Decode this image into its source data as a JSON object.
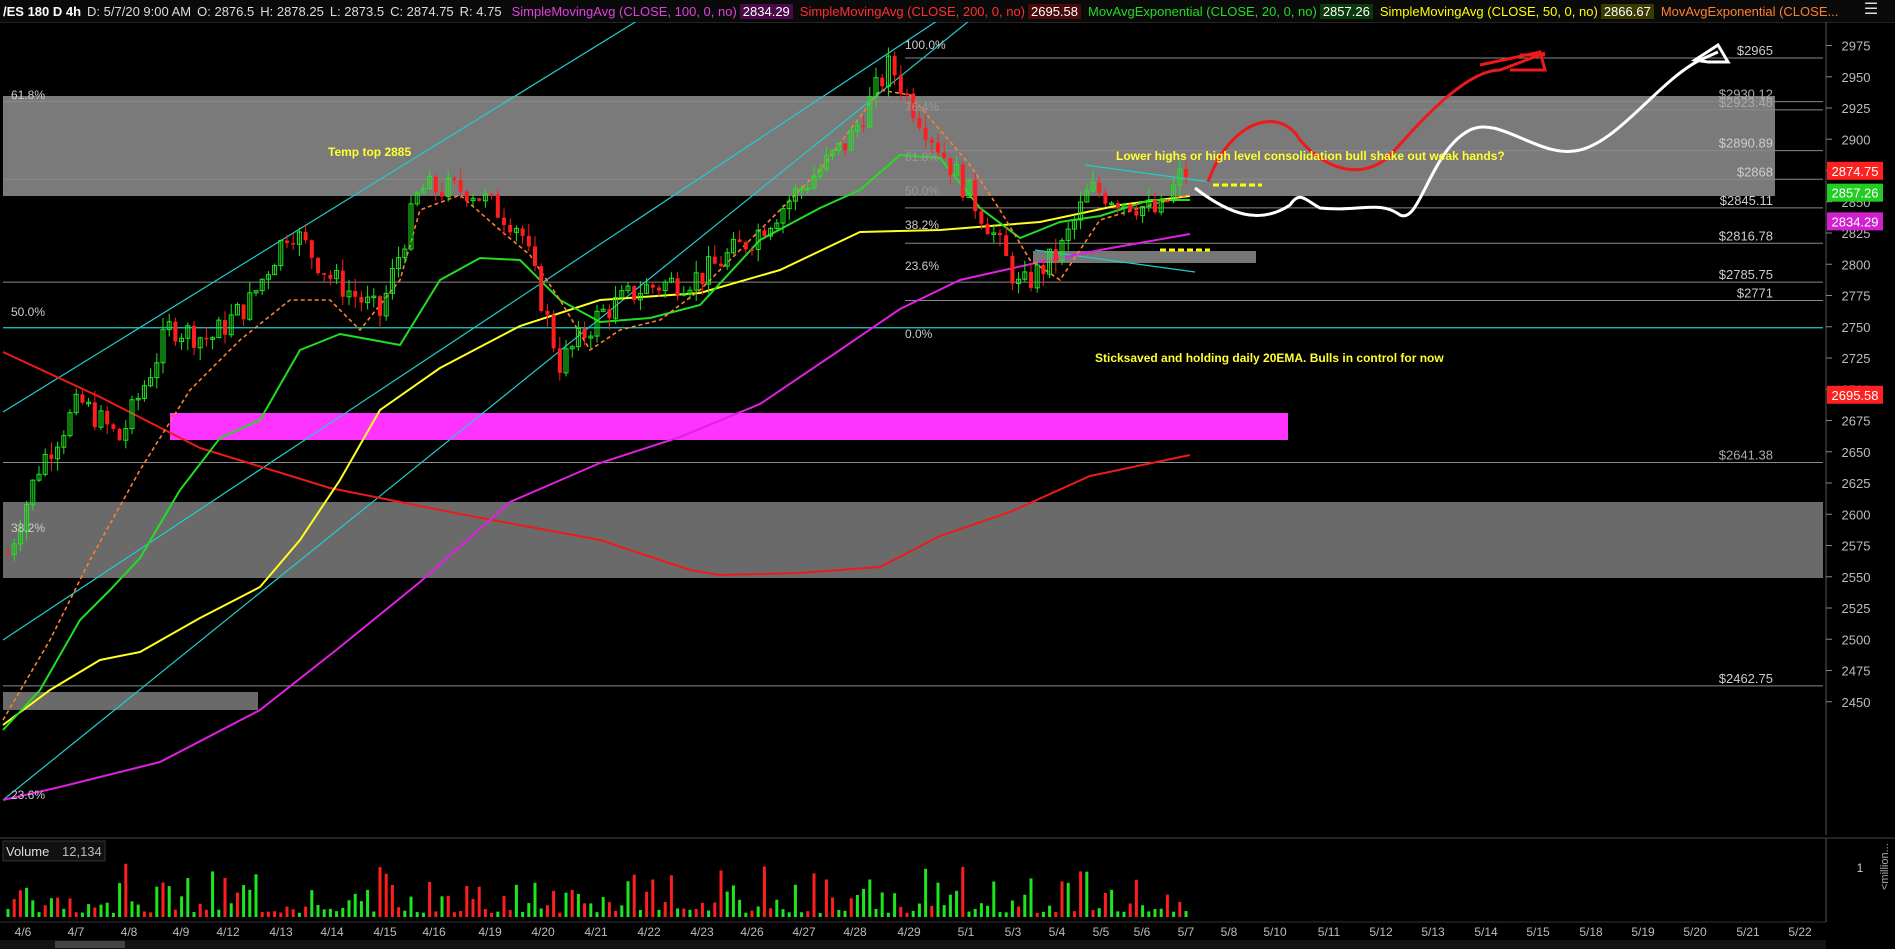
{
  "header": {
    "symbol": "/ES 180 D 4h",
    "date": "D: 5/7/20 9:00 AM",
    "open": "O: 2876.5",
    "high": "H: 2878.25",
    "low": "L: 2873.5",
    "close": "C: 2874.75",
    "range": "R: 4.75",
    "studies": [
      {
        "label": "SimpleMovingAvg (CLOSE, 100, 0, no)",
        "value": "2834.29",
        "color": "#e040e0"
      },
      {
        "label": "SimpleMovingAvg (CLOSE, 200, 0, no)",
        "value": "2695.58",
        "color": "#ff3030"
      },
      {
        "label": "MovAvgExponential (CLOSE, 20, 0, no)",
        "value": "2857.26",
        "color": "#22dd22"
      },
      {
        "label": "SimpleMovingAvg (CLOSE, 50, 0, no)",
        "value": "2866.67",
        "color": "#ffff00"
      },
      {
        "label": "MovAvgExponential (CLOSE...",
        "value": "",
        "color": "#ff8030"
      }
    ],
    "menu_icon": "hamburger-icon"
  },
  "chart_data": {
    "type": "candlestick",
    "x_ticks": [
      "4/6",
      "4/7",
      "4/8",
      "4/9",
      "4/12",
      "4/13",
      "4/14",
      "4/15",
      "4/16",
      "4/19",
      "4/20",
      "4/21",
      "4/22",
      "4/23",
      "4/26",
      "4/27",
      "4/28",
      "4/29",
      "5/1",
      "5/3",
      "5/4",
      "5/5",
      "5/6",
      "5/7",
      "5/8",
      "5/10",
      "5/11",
      "5/12",
      "5/13",
      "5/14",
      "5/15",
      "5/18",
      "5/19",
      "5/20",
      "5/21",
      "5/22"
    ],
    "y_ticks": [
      2975,
      2950,
      2925,
      2900,
      2875,
      2850,
      2825,
      2800,
      2775,
      2750,
      2725,
      2700,
      2675,
      2650,
      2625,
      2600,
      2575,
      2550,
      2525,
      2500,
      2475,
      2450
    ],
    "ylim": [
      2441,
      2986
    ],
    "last_price": {
      "value": "2874.75",
      "color": "#ff2020"
    },
    "price_tags": [
      {
        "value": "2857.26",
        "color": "#22cc22"
      },
      {
        "value": "2834.29",
        "color": "#d020d0"
      },
      {
        "value": "2695.58",
        "color": "#ff2020"
      }
    ],
    "fib_right_labels": [
      "$2965",
      "$2930.12",
      "$2923.48",
      "$2890.89",
      "$2868",
      "$2845.11",
      "$2816.78",
      "$2785.75",
      "$2771",
      "$2641.38",
      "$2462.75"
    ],
    "fib_left_labels": [
      "61.8%",
      "50.0%",
      "38.2%",
      "23.6%"
    ],
    "fib_mid_labels": [
      "100.0%",
      "76.4%",
      "61.8%",
      "50.0%",
      "38.2%",
      "23.6%",
      "0.0%"
    ],
    "annotations": [
      "Temp  top 2885",
      "Lower highs or high level consolidation bull shake out weak hands?",
      "Sticksaved and holding daily 20EMA. Bulls in control for now"
    ],
    "volume": {
      "label": "Volume",
      "value": "12,134",
      "axis_label": "1",
      "unit": "<million..."
    }
  }
}
